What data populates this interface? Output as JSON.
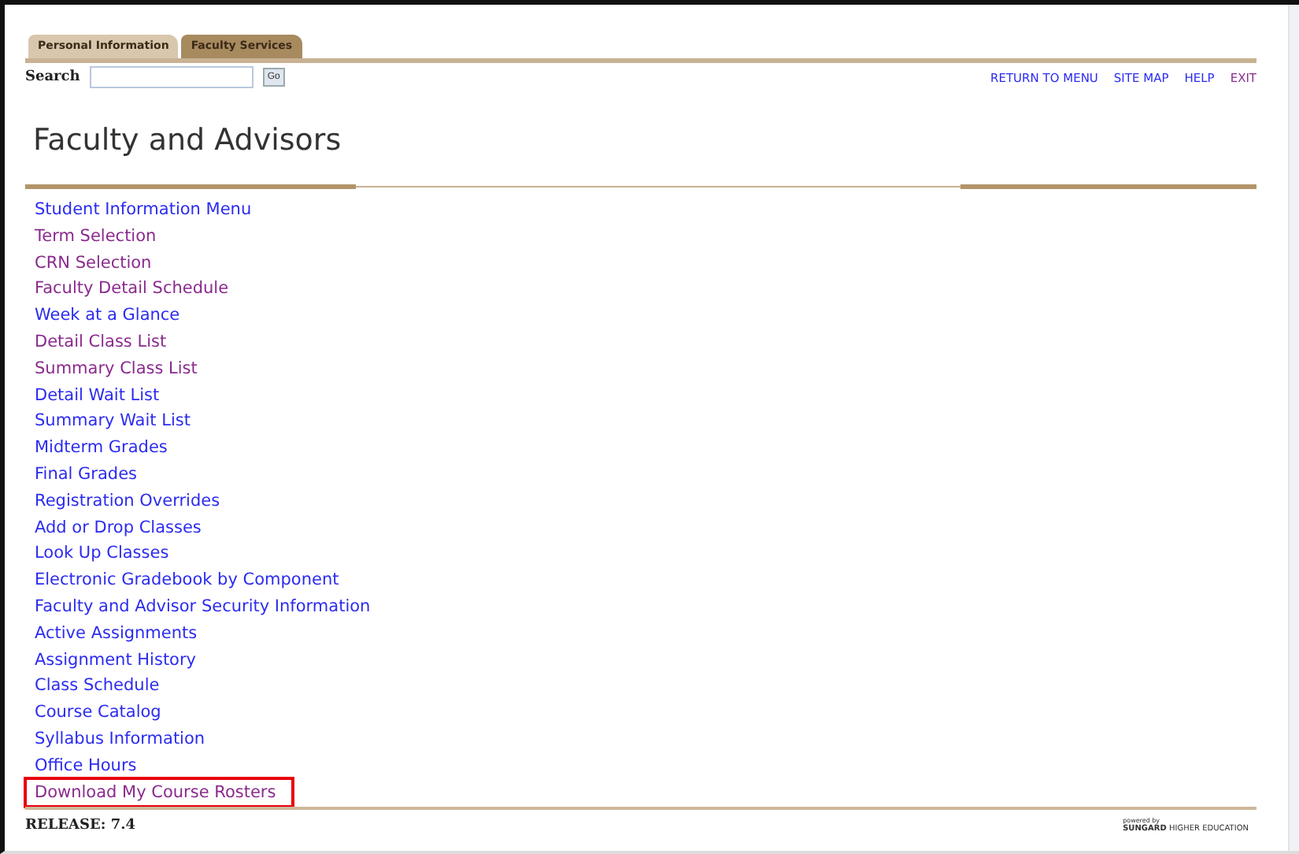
{
  "tabs": [
    {
      "label": "Personal Information",
      "selected": false
    },
    {
      "label": "Faculty Services",
      "selected": true
    }
  ],
  "search": {
    "label": "Search",
    "button": "Go"
  },
  "top_links": [
    {
      "label": "RETURN TO MENU",
      "visited": false
    },
    {
      "label": "SITE MAP",
      "visited": false
    },
    {
      "label": "HELP",
      "visited": false
    },
    {
      "label": "EXIT",
      "visited": true
    }
  ],
  "title": "Faculty and Advisors",
  "menu": [
    {
      "label": "Student Information Menu",
      "visited": false,
      "highlighted": false
    },
    {
      "label": "Term Selection",
      "visited": true,
      "highlighted": false
    },
    {
      "label": "CRN Selection",
      "visited": true,
      "highlighted": false
    },
    {
      "label": "Faculty Detail Schedule",
      "visited": true,
      "highlighted": false
    },
    {
      "label": "Week at a Glance",
      "visited": false,
      "highlighted": false
    },
    {
      "label": "Detail Class List",
      "visited": true,
      "highlighted": false
    },
    {
      "label": "Summary Class List",
      "visited": true,
      "highlighted": false
    },
    {
      "label": "Detail Wait List",
      "visited": false,
      "highlighted": false
    },
    {
      "label": "Summary Wait List",
      "visited": false,
      "highlighted": false
    },
    {
      "label": "Midterm Grades",
      "visited": false,
      "highlighted": false
    },
    {
      "label": "Final Grades",
      "visited": false,
      "highlighted": false
    },
    {
      "label": "Registration Overrides",
      "visited": false,
      "highlighted": false
    },
    {
      "label": "Add or Drop Classes",
      "visited": false,
      "highlighted": false
    },
    {
      "label": "Look Up Classes",
      "visited": false,
      "highlighted": false
    },
    {
      "label": "Electronic Gradebook by Component",
      "visited": false,
      "highlighted": false
    },
    {
      "label": "Faculty and Advisor Security Information",
      "visited": false,
      "highlighted": false
    },
    {
      "label": "Active Assignments",
      "visited": false,
      "highlighted": false
    },
    {
      "label": "Assignment History",
      "visited": false,
      "highlighted": false
    },
    {
      "label": "Class Schedule",
      "visited": false,
      "highlighted": false
    },
    {
      "label": "Course Catalog",
      "visited": false,
      "highlighted": false
    },
    {
      "label": "Syllabus Information",
      "visited": false,
      "highlighted": false
    },
    {
      "label": "Office Hours",
      "visited": false,
      "highlighted": false
    },
    {
      "label": "Download My Course Rosters",
      "visited": true,
      "highlighted": true
    }
  ],
  "footer": {
    "release": "RELEASE: 7.4",
    "powered_by": "powered by",
    "brand": "SUNGARD",
    "brand_suffix": "HIGHER EDUCATION"
  }
}
